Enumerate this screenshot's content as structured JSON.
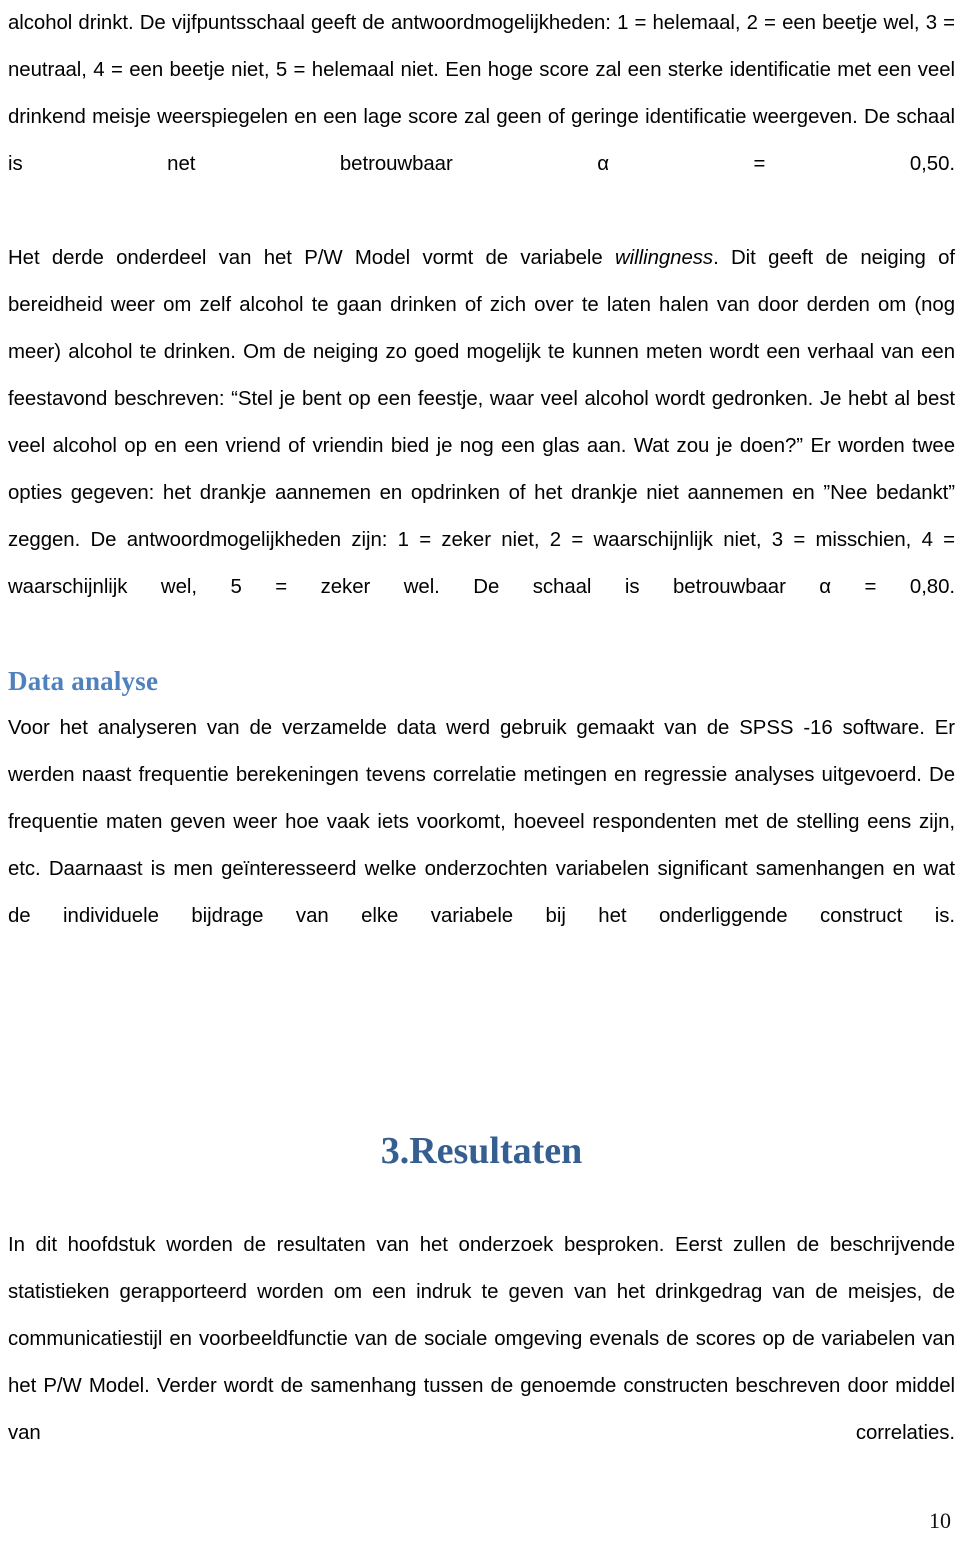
{
  "document": {
    "page_number": "10",
    "colors": {
      "heading2": "#4F81BD",
      "chapter_heading": "#365F91",
      "body_text": "#010101",
      "background": "#FFFFFF"
    }
  },
  "paragraphs": {
    "p1_continued": "alcohol drinkt. De vijfpuntsschaal geeft de antwoordmogelijkheden: 1 = helemaal, 2 = een beetje wel, 3 = neutraal, 4 = een beetje niet, 5 = helemaal niet. Een hoge score zal een sterke identificatie met een veel drinkend meisje weerspiegelen en een lage score zal geen of geringe identificatie weergeven. De schaal is net betrouwbaar α = 0,50.",
    "p2_before_italic": "Het derde onderdeel van het P/W Model vormt de variabele ",
    "p2_italic_word": "willingness",
    "p2_after_italic": ". Dit geeft de neiging of bereidheid weer om zelf alcohol te gaan drinken of zich over te laten halen van door derden om (nog meer) alcohol te drinken. Om de neiging zo goed mogelijk te kunnen meten wordt een verhaal van een feestavond beschreven: “Stel je bent op een feestje, waar veel alcohol wordt gedronken. Je hebt al best veel alcohol op en een vriend of vriendin bied je nog een glas aan. Wat zou je doen?” Er worden twee opties gegeven: het drankje aannemen en opdrinken of het drankje niet aannemen en ”Nee bedankt” zeggen. De antwoordmogelijkheden zijn: 1 = zeker niet, 2 = waarschijnlijk niet, 3 = misschien, 4 = waarschijnlijk wel, 5 = zeker wel. De schaal is betrouwbaar α = 0,80.",
    "p3_data_analyse": "Voor het analyseren van de verzamelde data werd gebruik gemaakt van de SPSS -16 software. Er werden naast frequentie berekeningen tevens correlatie metingen en regressie analyses uitgevoerd. De frequentie maten geven weer hoe vaak iets voorkomt, hoeveel respondenten met de stelling eens zijn, etc. Daarnaast is men geïnteresseerd welke onderzochten variabelen significant samenhangen en wat de individuele bijdrage van elke variabele bij het onderliggende construct is.",
    "p4_resultaten_intro": "In dit hoofdstuk worden de resultaten van het onderzoek besproken. Eerst zullen de beschrijvende statistieken gerapporteerd worden om een indruk te geven van het drinkgedrag van de meisjes, de communicatiestijl en voorbeeldfunctie van de sociale omgeving evenals de scores op de variabelen van het P/W Model. Verder wordt de samenhang tussen de genoemde constructen beschreven door middel van correlaties."
  },
  "headings": {
    "data_analyse": "Data analyse",
    "chapter_resultaten": "3.Resultaten"
  }
}
